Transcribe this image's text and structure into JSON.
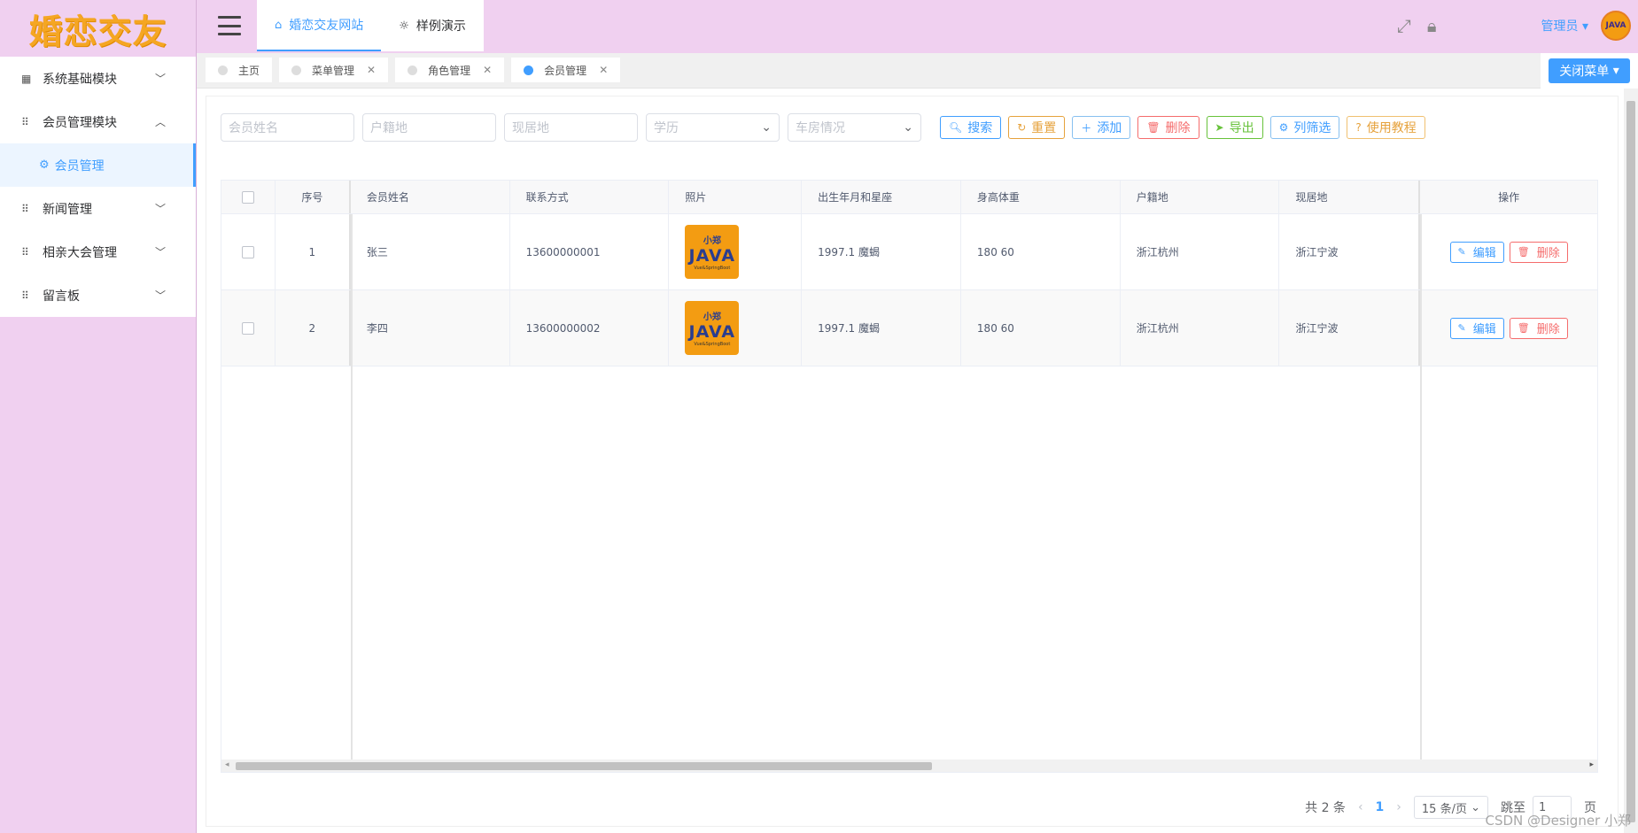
{
  "logo": "婚恋交友",
  "sidebar": {
    "items": [
      {
        "label": "系统基础模块",
        "icon": "chart-icon",
        "expanded": false
      },
      {
        "label": "会员管理模块",
        "icon": "grid-icon",
        "expanded": true
      },
      {
        "label": "新闻管理",
        "icon": "grid-icon",
        "expanded": false
      },
      {
        "label": "相亲大会管理",
        "icon": "grid-icon",
        "expanded": false
      },
      {
        "label": "留言板",
        "icon": "grid-icon",
        "expanded": false
      }
    ],
    "sub_active": "会员管理"
  },
  "header": {
    "tabs": [
      {
        "label": "婚恋交友网站",
        "icon": "home-icon",
        "active": true
      },
      {
        "label": "样例演示",
        "icon": "bulb-icon",
        "active": false
      }
    ],
    "user": "管理员",
    "avatar_text": "JAVA"
  },
  "tagbar": {
    "tags": [
      {
        "label": "主页",
        "closable": false,
        "active": false
      },
      {
        "label": "菜单管理",
        "closable": true,
        "active": false
      },
      {
        "label": "角色管理",
        "closable": true,
        "active": false
      },
      {
        "label": "会员管理",
        "closable": true,
        "active": true
      }
    ],
    "close_menu": "关闭菜单"
  },
  "filters": {
    "name_placeholder": "会员姓名",
    "hukou_placeholder": "户籍地",
    "residence_placeholder": "现居地",
    "education_placeholder": "学历",
    "property_placeholder": "车房情况"
  },
  "toolbar": {
    "search": "搜索",
    "reset": "重置",
    "add": "添加",
    "delete": "删除",
    "export": "导出",
    "columns": "列筛选",
    "tutorial": "使用教程"
  },
  "table": {
    "headers": {
      "index": "序号",
      "name": "会员姓名",
      "phone": "联系方式",
      "photo": "照片",
      "birth": "出生年月和星座",
      "hw": "身高体重",
      "hukou": "户籍地",
      "residence": "现居地",
      "ops": "操作"
    },
    "rows": [
      {
        "index": "1",
        "name": "张三",
        "phone": "13600000001",
        "birth": "1997.1 魔蝎",
        "hw": "180 60",
        "hukou": "浙江杭州",
        "residence": "浙江宁波",
        "photo_top": "小郑",
        "photo_main": "JAVA",
        "photo_bottom": "Vue&SpringBoot"
      },
      {
        "index": "2",
        "name": "李四",
        "phone": "13600000002",
        "birth": "1997.1 魔蝎",
        "hw": "180 60",
        "hukou": "浙江杭州",
        "residence": "浙江宁波",
        "photo_top": "小郑",
        "photo_main": "JAVA",
        "photo_bottom": "Vue&SpringBoot"
      }
    ],
    "edit_label": "编辑",
    "delete_label": "删除"
  },
  "pager": {
    "total": "共 2 条",
    "current": "1",
    "page_size": "15 条/页",
    "jump_label": "跳至",
    "jump_value": "1",
    "page_suffix": "页"
  },
  "watermark": "CSDN @Designer 小郑",
  "colors": {
    "primary": "#409eff",
    "sidebar_bg": "#f0d0f0",
    "logo": "#f5a623",
    "danger": "#f56c6c",
    "warning": "#e6a23c",
    "success": "#67c23a"
  }
}
